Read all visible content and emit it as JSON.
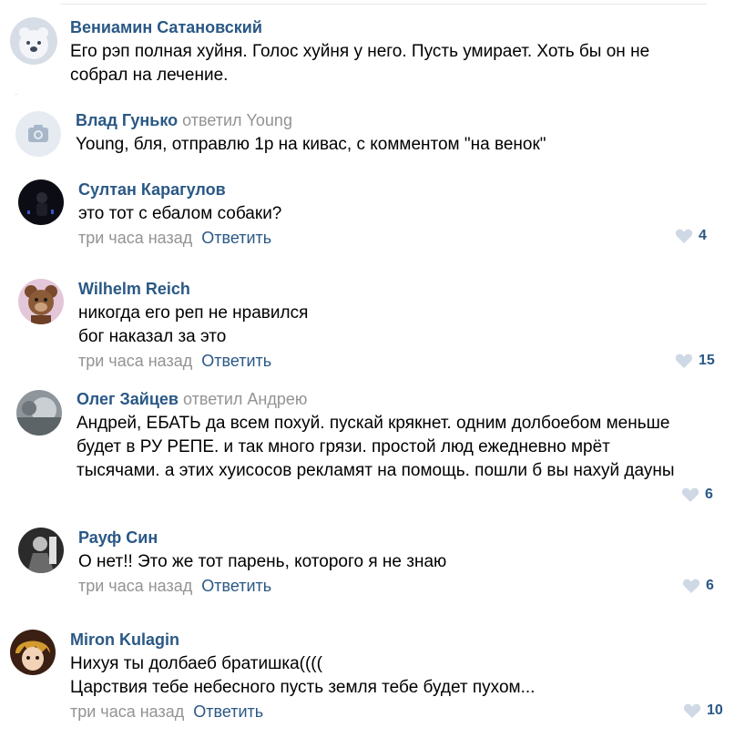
{
  "comments": [
    {
      "author": "Вениамин Сатановский",
      "reply_to": "",
      "text_lines": [
        "Его рэп полная хуйня. Голос хуйня у него. Пусть умирает. Хоть бы он не",
        "собрал на лечение."
      ],
      "time": "",
      "reply_label": "",
      "likes": "",
      "avatar": "polar-bear-avatar"
    },
    {
      "author": "Влад Гунько",
      "reply_to": "ответил Young",
      "text_lines": [
        "Young, бля, отправлю 1р на кивас, с комментом \"на венок\""
      ],
      "time": "",
      "reply_label": "",
      "likes": "",
      "avatar": "camera-placeholder-avatar"
    },
    {
      "author": "Султан Карагулов",
      "reply_to": "",
      "text_lines": [
        "это тот с ебалом собаки?"
      ],
      "time": "три часа назад",
      "reply_label": "Ответить",
      "likes": "4",
      "avatar": "dark-photo-avatar"
    },
    {
      "author": "Wilhelm Reich",
      "reply_to": "",
      "text_lines": [
        "никогда его реп не нравился",
        "бог наказал за это"
      ],
      "time": "три часа назад",
      "reply_label": "Ответить",
      "likes": "15",
      "avatar": "bear-mascot-avatar"
    },
    {
      "author": "Олег Зайцев",
      "reply_to": "ответил Андрею",
      "text_lines": [
        "Андрей, ЕБАТЬ да всем похуй. пускай крякнет. одним долбоебом меньше",
        "будет в РУ РЕПЕ. и так много грязи. простой люд ежедневно мрёт",
        "тысячами. а этих хуисосов рекламят на помощь. пошли б вы нахуй дауны"
      ],
      "time": "",
      "reply_label": "",
      "likes": "6",
      "avatar": "blurry-photo-avatar"
    },
    {
      "author": "Рауф Син",
      "reply_to": "",
      "text_lines": [
        "О нет!! Это же тот парень, которого я не знаю"
      ],
      "time": "три часа назад",
      "reply_label": "Ответить",
      "likes": "6",
      "avatar": "bw-photo-avatar"
    },
    {
      "author": "Miron Kulagin",
      "reply_to": "",
      "text_lines": [
        "Нихуя ты долбаеб братишка((((",
        "Царствия тебе небесного пусть земля тебе будет пухом..."
      ],
      "time": "три часа назад",
      "reply_label": "Ответить",
      "likes": "10",
      "avatar": "anime-avatar"
    }
  ],
  "colors": {
    "author": "#2a5885",
    "muted": "#939393",
    "heart": "#cfd9e5",
    "divider": "#eceef2"
  },
  "icons": {
    "like": "heart-icon",
    "placeholder": "camera-icon"
  }
}
